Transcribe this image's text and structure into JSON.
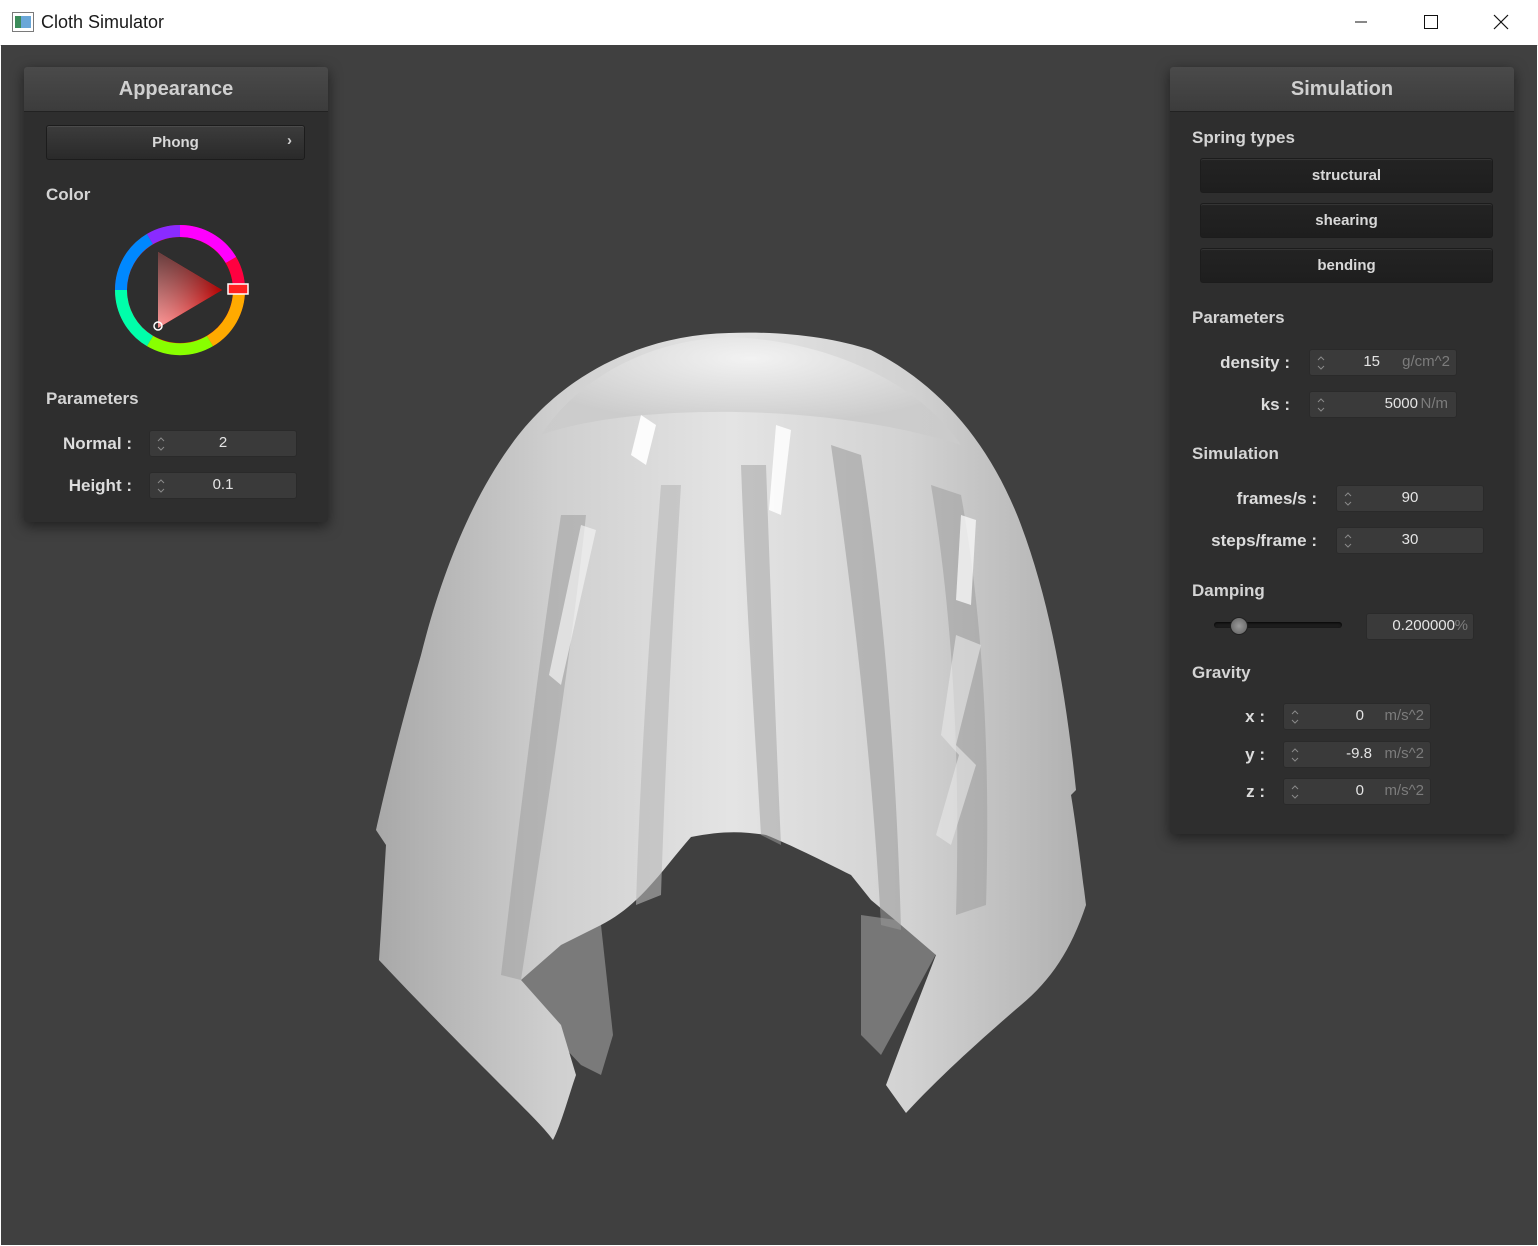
{
  "window": {
    "title": "Cloth Simulator"
  },
  "appearance": {
    "title": "Appearance",
    "shader": "Phong",
    "color_label": "Color",
    "selected_color": "#ff0000",
    "parameters_label": "Parameters",
    "normal": {
      "label": "Normal :",
      "value": "2"
    },
    "height": {
      "label": "Height :",
      "value": "0.1"
    }
  },
  "simulation": {
    "title": "Simulation",
    "spring_types_label": "Spring types",
    "spring_types": [
      "structural",
      "shearing",
      "bending"
    ],
    "parameters_label": "Parameters",
    "density": {
      "label": "density :",
      "value": "15",
      "unit": "g/cm^2"
    },
    "ks": {
      "label": "ks :",
      "value": "5000",
      "unit": "N/m"
    },
    "simulation_label": "Simulation",
    "fps": {
      "label": "frames/s :",
      "value": "90"
    },
    "steps": {
      "label": "steps/frame :",
      "value": "30"
    },
    "damping_label": "Damping",
    "damping": {
      "value": "0.200000",
      "unit": "%",
      "slider_fraction": 0.2
    },
    "gravity_label": "Gravity",
    "gravity": [
      {
        "label": "x :",
        "value": "0",
        "unit": "m/s^2"
      },
      {
        "label": "y :",
        "value": "-9.8",
        "unit": "m/s^2"
      },
      {
        "label": "z :",
        "value": "0",
        "unit": "m/s^2"
      }
    ]
  },
  "colors": {
    "viewport_bg": "#404040",
    "panel_bg": "#2e2e2e",
    "cloth": "#d6d6d6"
  }
}
